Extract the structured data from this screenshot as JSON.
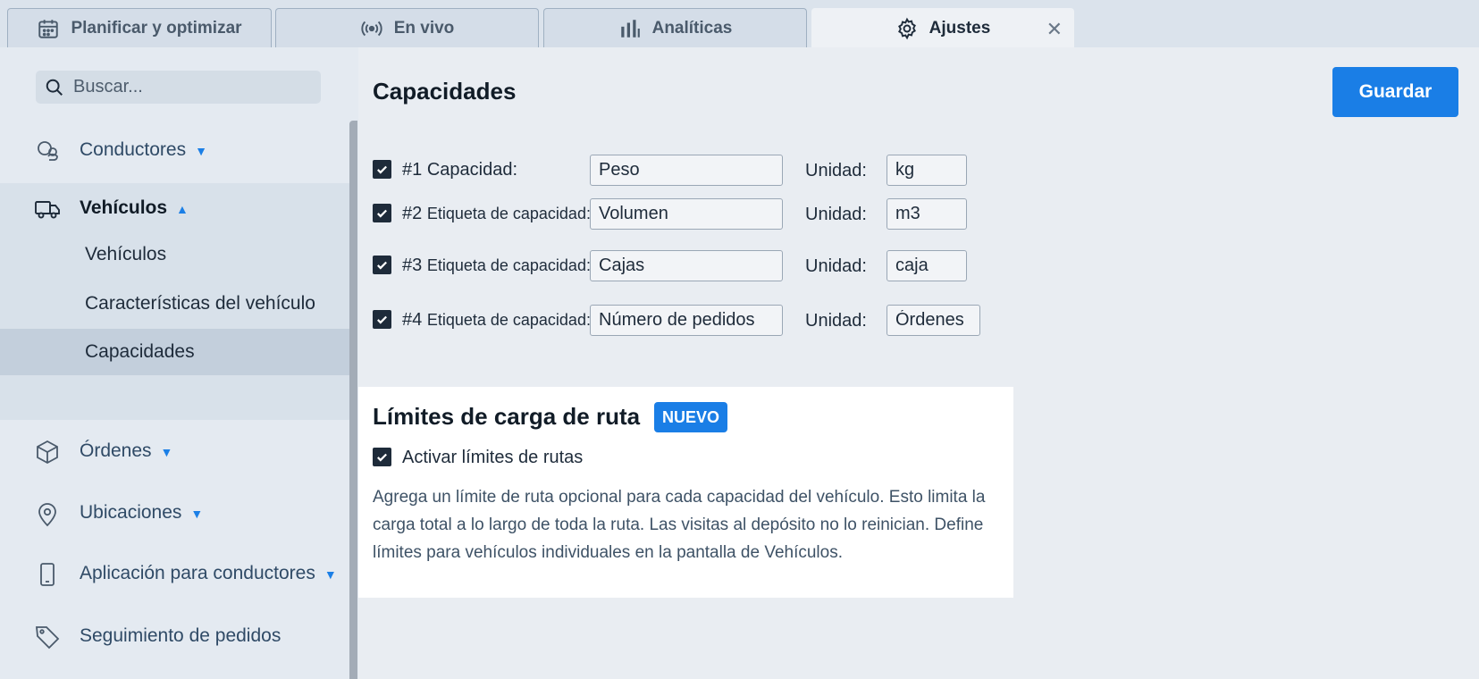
{
  "tabs": [
    {
      "label": "Planificar y optimizar",
      "icon": "calendar-icon",
      "active": false
    },
    {
      "label": "En vivo",
      "icon": "broadcast-icon",
      "active": false
    },
    {
      "label": "Analíticas",
      "icon": "bar-chart-icon",
      "active": false
    },
    {
      "label": "Ajustes",
      "icon": "gear-icon",
      "active": true
    }
  ],
  "tab_close": "✕",
  "search": {
    "placeholder": "Buscar..."
  },
  "sidebar": {
    "items": [
      {
        "label": "Conductores",
        "icon": "users-icon",
        "caret": "▼"
      },
      {
        "label": "Vehículos",
        "icon": "truck-icon",
        "caret": "▲",
        "expanded": true
      },
      {
        "label": "Órdenes",
        "icon": "box-icon",
        "caret": "▼"
      },
      {
        "label": "Ubicaciones",
        "icon": "location-pin-icon",
        "caret": "▼"
      },
      {
        "label": "Aplicación para conductores",
        "icon": "phone-icon",
        "caret": "▼"
      },
      {
        "label": "Seguimiento de pedidos",
        "icon": "tag-icon"
      }
    ],
    "vehicle_subitems": [
      {
        "label": "Vehículos"
      },
      {
        "label": "Características del vehículo"
      },
      {
        "label": "Capacidades",
        "selected": true
      }
    ]
  },
  "main": {
    "title": "Capacidades",
    "save_label": "Guardar",
    "unit_label": "Unidad:",
    "capacities": [
      {
        "prefix": "#1",
        "label": "Capacidad:",
        "value": "Peso",
        "unit": "kg",
        "checked": true
      },
      {
        "prefix": "#2",
        "label": "Etiqueta de capacidad:",
        "value": "Volumen",
        "unit": "m3",
        "checked": true
      },
      {
        "prefix": "#3",
        "label": "Etiqueta de capacidad:",
        "value": "Cajas",
        "unit": "caja",
        "checked": true
      },
      {
        "prefix": "#4",
        "label": "Etiqueta de capacidad:",
        "value": "Número de pedidos",
        "unit": "Órdenes",
        "checked": true
      }
    ],
    "route_limits": {
      "title": "Límites de carga de ruta",
      "badge": "NUEVO",
      "checkbox_label": "Activar límites de rutas",
      "checked": true,
      "description": "Agrega un límite de ruta opcional para cada capacidad del vehículo. Esto limita la carga total a lo largo de toda la ruta. Las visitas al depósito no lo reinician. Define límites para vehículos individuales en la pantalla de Vehículos."
    }
  },
  "colors": {
    "accent": "#1a7ee6",
    "sidebar_bg": "#e4eaf1",
    "selected_bg": "#c3cfdc"
  }
}
